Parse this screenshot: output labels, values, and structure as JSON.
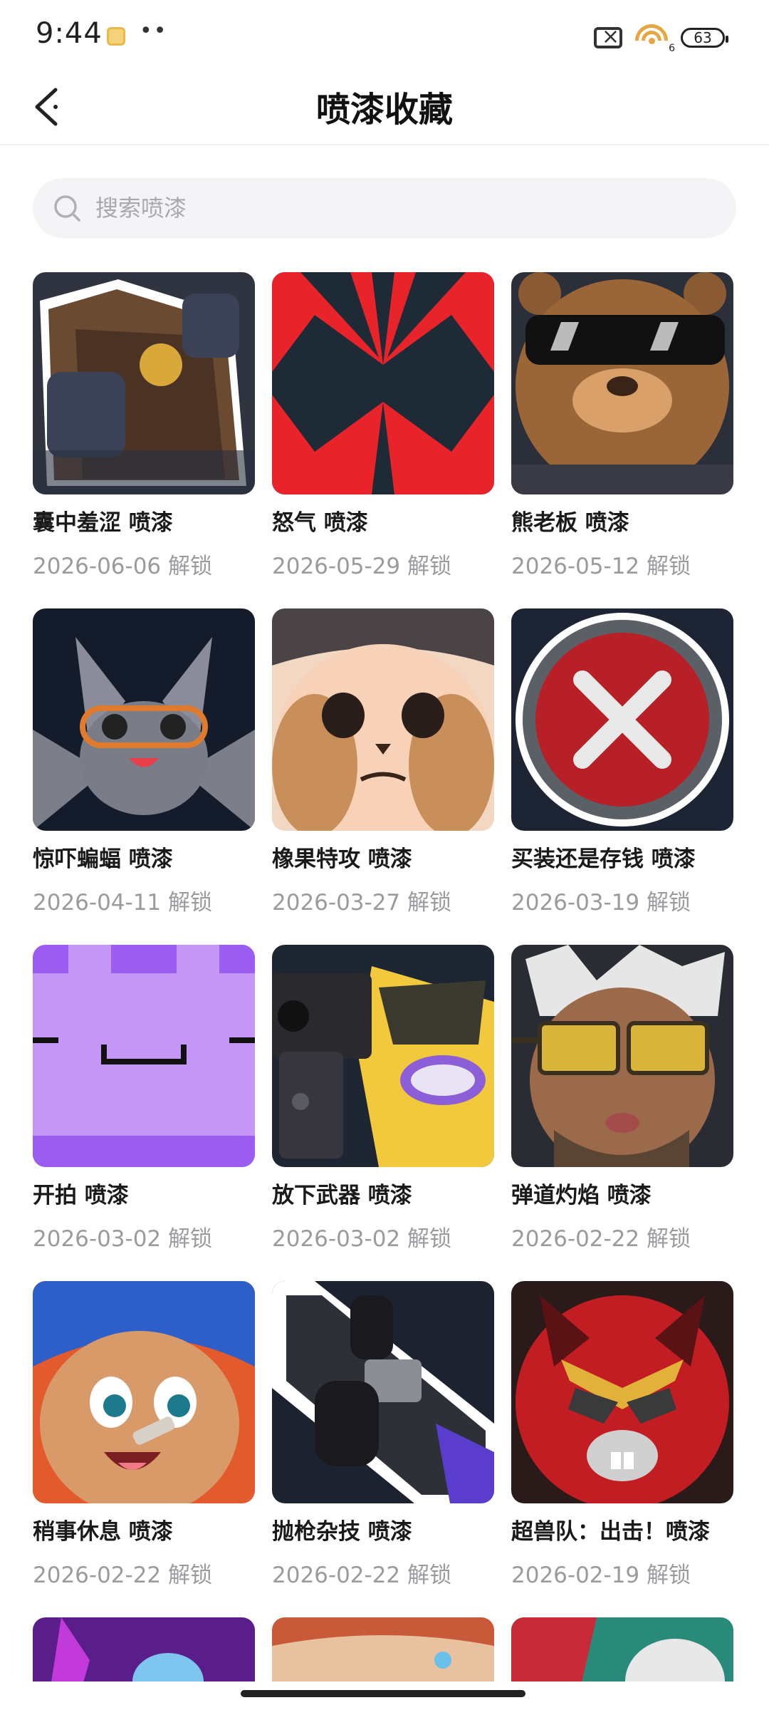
{
  "status_bar": {
    "time": "9:44",
    "dots": "••",
    "battery": "63",
    "wifi_badge": "6"
  },
  "header": {
    "title": "喷漆收藏",
    "back_icon": "chevron-left-icon"
  },
  "search": {
    "placeholder": "搜索喷漆",
    "value": ""
  },
  "sprays": [
    {
      "title": "囊中羞涩 喷漆",
      "subtitle": "2026-06-06 解锁"
    },
    {
      "title": "怒气 喷漆",
      "subtitle": "2026-05-29 解锁"
    },
    {
      "title": "熊老板 喷漆",
      "subtitle": "2026-05-12 解锁"
    },
    {
      "title": "惊吓蝙蝠 喷漆",
      "subtitle": "2026-04-11 解锁"
    },
    {
      "title": "橡果特攻 喷漆",
      "subtitle": "2026-03-27 解锁"
    },
    {
      "title": "买装还是存钱 喷漆",
      "subtitle": "2026-03-19 解锁"
    },
    {
      "title": "开拍 喷漆",
      "subtitle": "2026-03-02 解锁"
    },
    {
      "title": "放下武器 喷漆",
      "subtitle": "2026-03-02 解锁"
    },
    {
      "title": "弹道灼焰 喷漆",
      "subtitle": "2026-02-22 解锁"
    },
    {
      "title": "稍事休息 喷漆",
      "subtitle": "2026-02-22 解锁"
    },
    {
      "title": "抛枪杂技 喷漆",
      "subtitle": "2026-02-22 解锁"
    },
    {
      "title": "超兽队：出击！喷漆",
      "subtitle": "2026-02-19 解锁"
    }
  ],
  "colors": {
    "accent_red": "#e8242a",
    "purple": "#b886f2",
    "gray_text": "#9b9b9f"
  }
}
